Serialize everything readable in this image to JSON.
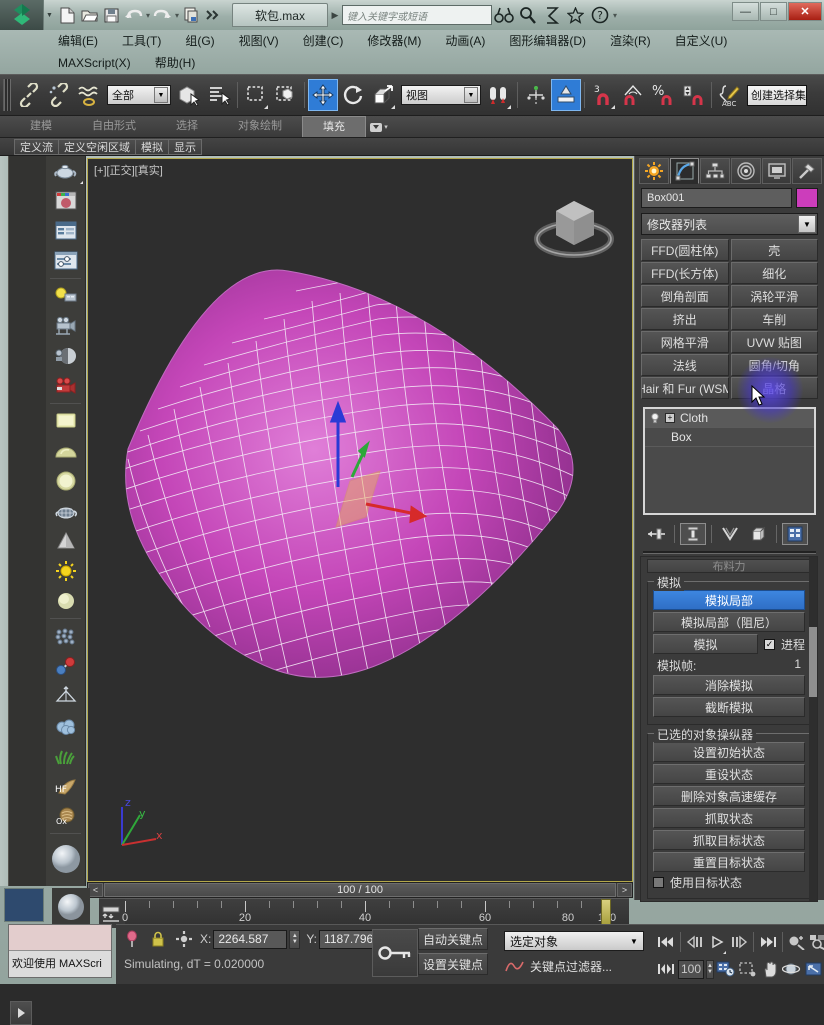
{
  "window": {
    "file_tab": "软包.max",
    "search_placeholder": "键入关键字或短语",
    "minimize": "—",
    "maximize": "□",
    "close": "✕"
  },
  "quick_access": {
    "items": [
      {
        "name": "new-file-icon",
        "label": "新建"
      },
      {
        "name": "open-file-icon",
        "label": "打开"
      },
      {
        "name": "save-file-icon",
        "label": "保存"
      },
      {
        "name": "undo-icon",
        "label": "撤消"
      },
      {
        "name": "redo-icon",
        "label": "重做"
      },
      {
        "name": "project-folder-icon",
        "label": "项目文件夹"
      },
      {
        "name": "more-commands-icon",
        "label": "更多"
      }
    ],
    "right_icons": [
      {
        "name": "binoculars-icon",
        "label": "查找"
      },
      {
        "name": "magnifier-icon",
        "label": "缩放"
      },
      {
        "name": "workspace-icon",
        "label": "工作区"
      },
      {
        "name": "star-icon",
        "label": "收藏"
      },
      {
        "name": "help-icon",
        "label": "帮助"
      }
    ]
  },
  "menu": {
    "row1": [
      "编辑(E)",
      "工具(T)",
      "组(G)",
      "视图(V)",
      "创建(C)",
      "修改器(M)",
      "动画(A)",
      "图形编辑器(D)",
      "渲染(R)",
      "自定义(U)"
    ],
    "row2": [
      "MAXScript(X)",
      "帮助(H)"
    ]
  },
  "main_toolbar": {
    "selection_filter": "全部",
    "reference_coord": "视图",
    "snap_count": "3",
    "selection_set_value": "创建选择集",
    "icons": [
      {
        "name": "select-link-icon"
      },
      {
        "name": "unlink-icon"
      },
      {
        "name": "bind-space-warp-icon"
      },
      {
        "name": "select-object-icon"
      },
      {
        "name": "select-by-name-icon"
      },
      {
        "name": "rect-selection-region-icon"
      },
      {
        "name": "window-crossing-icon"
      },
      {
        "name": "select-and-move-icon"
      },
      {
        "name": "select-and-rotate-icon"
      },
      {
        "name": "select-and-scale-icon"
      },
      {
        "name": "use-pivot-point-center-icon"
      },
      {
        "name": "mirror-icon"
      },
      {
        "name": "align-icon"
      },
      {
        "name": "snaps-toggle-icon"
      },
      {
        "name": "angle-snap-icon"
      },
      {
        "name": "percent-snap-icon"
      },
      {
        "name": "spinner-snap-icon"
      },
      {
        "name": "named-selection-sets-icon"
      }
    ]
  },
  "ribbon": {
    "tabs": [
      "建模",
      "自由形式",
      "选择",
      "对象绘制",
      "填充"
    ],
    "active_tab": "填充",
    "subtabs": [
      "定义流",
      "定义空闲区域",
      "模拟",
      "显示"
    ]
  },
  "left_toolbar": {
    "items": [
      {
        "name": "teapot-icon"
      },
      {
        "name": "material-preview-icon"
      },
      {
        "name": "list-window-icon"
      },
      {
        "name": "slider-window-icon"
      },
      {
        "name": "light-icon"
      },
      {
        "name": "camera-icon"
      },
      {
        "name": "shaded-sphere-icon"
      },
      {
        "name": "render-camera-icon"
      },
      {
        "name": "plane-primitive-icon"
      },
      {
        "name": "dome-primitive-icon"
      },
      {
        "name": "sphere-primitive-icon"
      },
      {
        "name": "mesh-teapot-icon"
      },
      {
        "name": "cone-primitive-icon"
      },
      {
        "name": "sun-light-icon"
      },
      {
        "name": "sphere-gizmo-icon"
      },
      {
        "name": "particle-array-icon"
      },
      {
        "name": "molecule-icon"
      },
      {
        "name": "space-warp-icon"
      },
      {
        "name": "cloud-icon"
      },
      {
        "name": "grass-icon"
      },
      {
        "name": "hair-fur-icon"
      },
      {
        "name": "ox-hair-icon"
      },
      {
        "name": "material-ball-icon"
      }
    ]
  },
  "viewport": {
    "label": "[+][正交][真实]",
    "frame_display": "100 / 100",
    "scroll_prev": "<",
    "scroll_next": ">",
    "axis_labels": {
      "x": "x",
      "y": "y",
      "z": "z"
    },
    "object_color": "#c94fc1"
  },
  "command_panel": {
    "tabs": [
      {
        "name": "create-tab",
        "label": "创建"
      },
      {
        "name": "modify-tab",
        "label": "修改"
      },
      {
        "name": "hierarchy-tab",
        "label": "层次"
      },
      {
        "name": "motion-tab",
        "label": "运动"
      },
      {
        "name": "display-tab",
        "label": "显示"
      },
      {
        "name": "utilities-tab",
        "label": "工具"
      }
    ],
    "active_tab": "修改",
    "object_name": "Box001",
    "object_color": "#cc3dbb",
    "modifier_list_label": "修改器列表",
    "modifier_buttons": [
      "FFD(圆柱体)",
      "壳",
      "FFD(长方体)",
      "细化",
      "倒角剖面",
      "涡轮平滑",
      "挤出",
      "车削",
      "网格平滑",
      "UVW 贴图",
      "法线",
      "圆角/切角",
      "Hair 和 Fur (WSM",
      "晶格"
    ],
    "stack": [
      {
        "label": "Cloth",
        "selected": true,
        "has_plus": true
      },
      {
        "label": "Box",
        "selected": false,
        "has_plus": false
      }
    ],
    "stack_tools": [
      {
        "name": "pin-stack-icon"
      },
      {
        "name": "show-end-result-icon"
      },
      {
        "name": "make-unique-icon"
      },
      {
        "name": "remove-modifier-icon"
      },
      {
        "name": "configure-modifier-sets-icon"
      }
    ]
  },
  "rollouts": {
    "partial_top_label": "布料力",
    "simulation": {
      "group_label": "模拟",
      "buttons": {
        "simulate_local": "模拟局部",
        "simulate_local_damped": "模拟局部（阻尼）",
        "simulate": "模拟",
        "erase_simulation": "消除模拟",
        "truncate_simulation": "截断模拟"
      },
      "progress_label": "进程",
      "progress_checked": true,
      "sim_frame_label": "模拟帧:",
      "sim_frame_value": "1"
    },
    "object_manipulator": {
      "group_label": "已选的对象操纵器",
      "buttons": [
        "设置初始状态",
        "重设状态",
        "删除对象高速缓存",
        "抓取状态",
        "抓取目标状态",
        "重置目标状态"
      ],
      "use_target_state_label": "使用目标状态",
      "use_target_state_checked": false
    }
  },
  "timeline": {
    "ticks": [
      0,
      20,
      40,
      60,
      80,
      100
    ],
    "current": 100,
    "range_max": 100
  },
  "status": {
    "welcome_message": "欢迎使用 MAXScri",
    "sim_message": "Simulating, dT = 0.020000",
    "x_label": "X:",
    "x_value": "2264.587",
    "y_label": "Y:",
    "y_value": "1187.796",
    "lock_icon": "lock-icon",
    "pin_icon": "pin-icon",
    "abs_rel_icon": "absolute-relative-icon"
  },
  "animation_controls": {
    "auto_key": "自动关键点",
    "set_key": "设置关键点",
    "key_mode": "选定对象",
    "key_filters": "关键点过滤器...",
    "current_frame": "100",
    "transport": [
      {
        "name": "goto-start-icon"
      },
      {
        "name": "previous-frame-icon"
      },
      {
        "name": "play-animation-icon"
      },
      {
        "name": "next-frame-icon"
      },
      {
        "name": "goto-end-icon"
      },
      {
        "name": "key-mode-toggle-icon"
      }
    ],
    "viewport_nav": [
      {
        "name": "zoom-icon"
      },
      {
        "name": "zoom-all-icon"
      },
      {
        "name": "zoom-extents-icon"
      },
      {
        "name": "zoom-extents-all-icon"
      },
      {
        "name": "field-of-view-icon"
      },
      {
        "name": "region-zoom-icon"
      },
      {
        "name": "pan-view-icon"
      },
      {
        "name": "orbit-icon"
      },
      {
        "name": "maximize-viewport-icon"
      }
    ]
  }
}
